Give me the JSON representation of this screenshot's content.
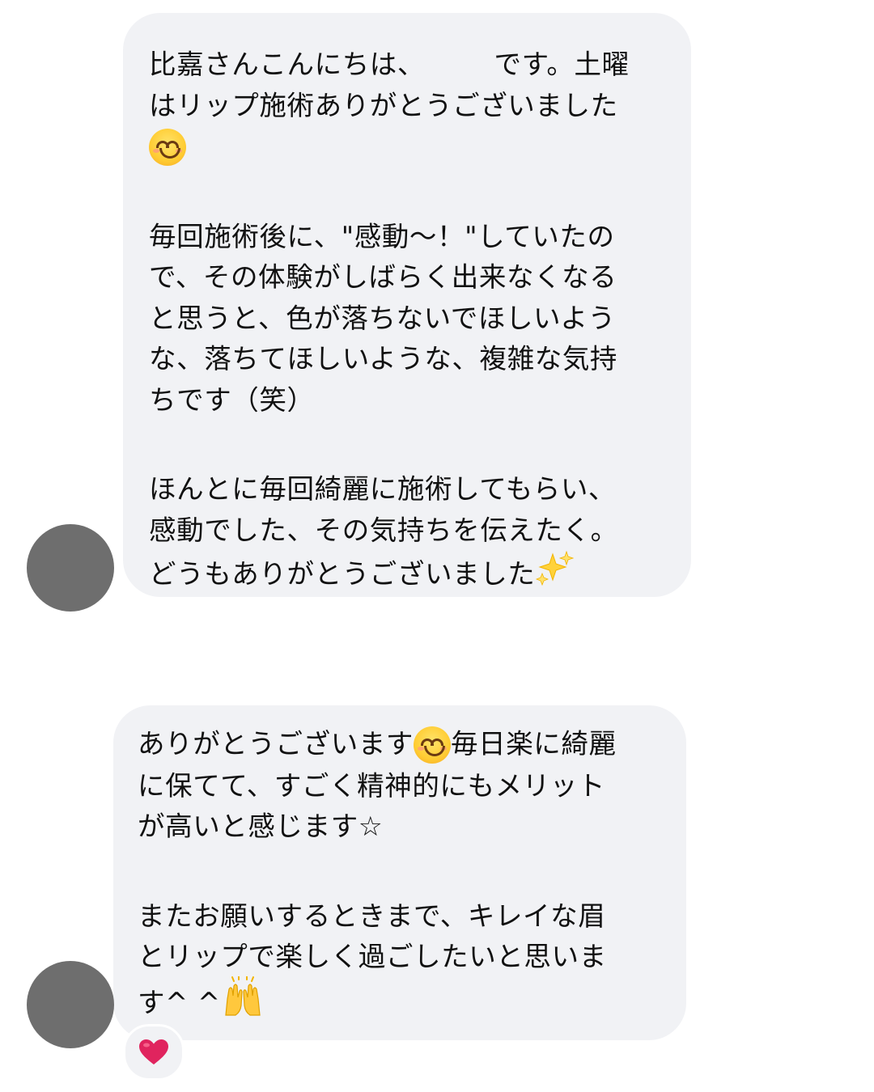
{
  "thread": {
    "message1": {
      "lines_p1a": "比嘉さんこんにちは、　　　です。土曜",
      "lines_p1b": "はリップ施術ありがとうございました",
      "lines_p2a": "毎回施術後に、\"感動〜！\"していたの",
      "lines_p2b": "で、その体験がしばらく出来なくなる",
      "lines_p2c": "と思うと、色が落ちないでほしいよう",
      "lines_p2d": "な、落ちてほしいような、複雑な気持",
      "lines_p2e": "ちです（笑）",
      "lines_p3a": "ほんとに毎回綺麗に施術してもらい、",
      "lines_p3b": "感動でした、その気持ちを伝えたく。",
      "lines_p3c": "どうもありがとうございました",
      "emoji_smile": "smiling-face-emoji",
      "emoji_sparkles": "sparkles-emoji"
    },
    "message2": {
      "lines_p1a_pre": "ありがとうございます",
      "lines_p1a_post": "毎日楽に綺麗",
      "lines_p1b": "に保てて、すごく精神的にもメリット",
      "lines_p1c": "が高いと感じます☆",
      "lines_p2a": "またお願いするときまで、キレイな眉",
      "lines_p2b": "とリップで楽しく過ごしたいと思いま",
      "lines_p2c": "す^ ^",
      "emoji_smile": "smiling-face-emoji",
      "emoji_raised_hands": "raising-hands-emoji"
    },
    "reaction": {
      "icon": "red-heart-icon",
      "color": "#e0245e"
    },
    "colors": {
      "bubble": "#f1f2f5",
      "avatar": "#6e6e6e",
      "text": "#111111"
    }
  }
}
